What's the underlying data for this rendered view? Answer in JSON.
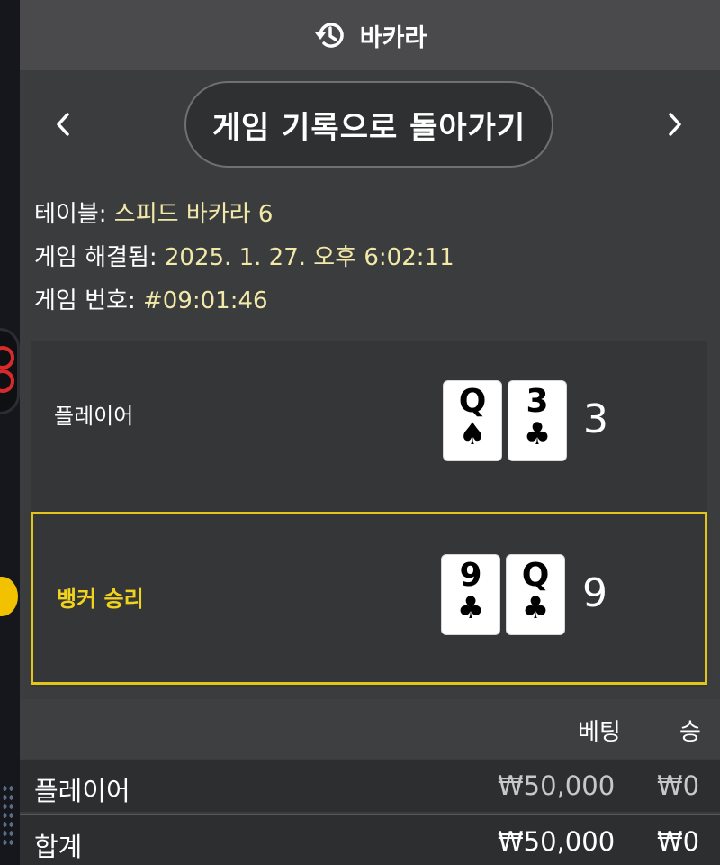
{
  "header": {
    "title": "바카라",
    "icon": "history-icon"
  },
  "nav": {
    "back_label": "게임 기록으로 돌아가기",
    "prev_icon": "chevron-left-icon",
    "next_icon": "chevron-right-icon"
  },
  "info": {
    "table_label": "테이블:",
    "table_value": "스피드 바카라 6",
    "resolved_label": "게임 해결됨:",
    "resolved_value": "2025. 1. 27. 오후 6:02:11",
    "number_label": "게임 번호:",
    "number_value": "#09:01:46"
  },
  "results": {
    "player": {
      "label": "플레이어",
      "cards": [
        {
          "rank": "Q",
          "suit": "♠"
        },
        {
          "rank": "3",
          "suit": "♣"
        }
      ],
      "score": "3"
    },
    "banker": {
      "label": "뱅커 승리",
      "cards": [
        {
          "rank": "9",
          "suit": "♣"
        },
        {
          "rank": "Q",
          "suit": "♣"
        }
      ],
      "score": "9"
    }
  },
  "bets_table": {
    "headers": {
      "bet": "베팅",
      "win": "승"
    },
    "rows": [
      {
        "name": "플레이어",
        "bet": "₩50,000",
        "win": "₩0"
      },
      {
        "name": "합계",
        "bet": "₩50,000",
        "win": "₩0"
      }
    ]
  },
  "colors": {
    "accent": "#f1d21c",
    "panel": "#3b3c3e",
    "header": "#4a4a4c"
  }
}
